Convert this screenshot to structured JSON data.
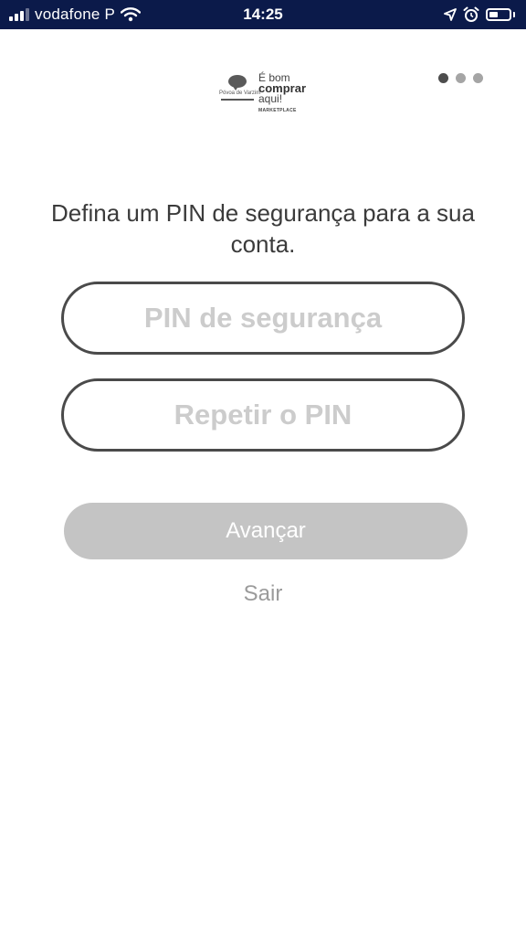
{
  "status_bar": {
    "carrier": "vodafone P",
    "time": "14:25",
    "icons": [
      "signal-icon",
      "wifi-icon",
      "location-icon",
      "alarm-icon",
      "battery-icon"
    ],
    "background_color": "#0b1a4a",
    "battery_level": 0.45
  },
  "logo": {
    "city_text": "Póvoa de Varzim",
    "line1": "É bom",
    "line2": "comprar",
    "line3": "aqui!",
    "tag": "MARKETPLACE"
  },
  "pager": {
    "total": 3,
    "current": 1
  },
  "form": {
    "instruction": "Defina um PIN de segurança para a sua conta.",
    "pin_placeholder": "PIN de segurança",
    "pin_value": "",
    "repeat_placeholder": "Repetir o PIN",
    "repeat_value": ""
  },
  "actions": {
    "next_label": "Avançar",
    "exit_label": "Sair"
  },
  "colors": {
    "button_disabled": "#c4c4c4",
    "field_border": "#4a4a4a",
    "placeholder": "#cccccc"
  }
}
